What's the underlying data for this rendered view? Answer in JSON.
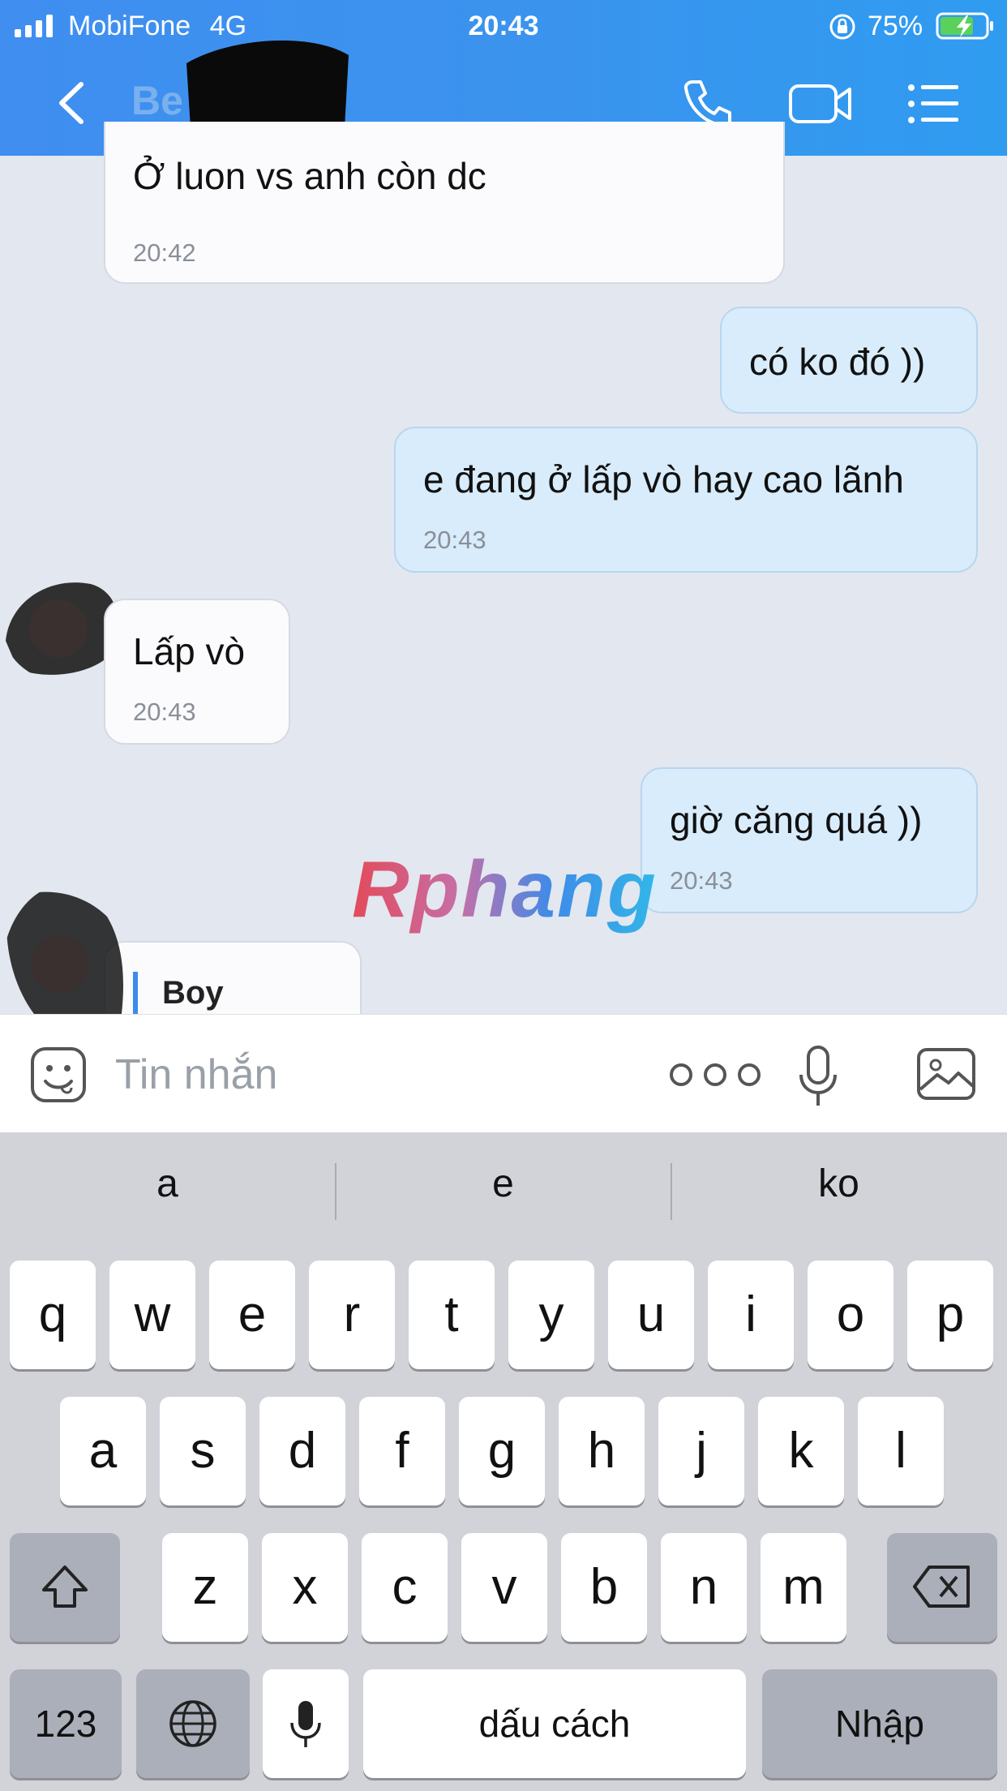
{
  "status_bar": {
    "carrier": "MobiFone",
    "network": "4G",
    "time": "20:43",
    "battery": "75%",
    "icons": [
      "signal-bars-icon",
      "orientation-lock-icon",
      "battery-charging-icon"
    ]
  },
  "header": {
    "contact_name": "Be",
    "actions": [
      "back-icon",
      "phone-icon",
      "video-call-icon",
      "menu-icon"
    ]
  },
  "messages": [
    {
      "direction": "incoming",
      "text": "Ở luon vs anh còn dc",
      "time": "20:42"
    },
    {
      "direction": "outgoing",
      "text": "có ko đó ))",
      "time": ""
    },
    {
      "direction": "outgoing",
      "text": "e đang ở lấp vò hay cao lãnh",
      "time": "20:43"
    },
    {
      "direction": "incoming",
      "text": "Lấp vò",
      "time": "20:43"
    },
    {
      "direction": "outgoing",
      "text": "giờ căng quá ))",
      "time": "20:43"
    },
    {
      "direction": "incoming",
      "reply_to": "Boy",
      "text": "",
      "time": ""
    }
  ],
  "watermark": "Rphang",
  "composer": {
    "placeholder": "Tin nhắn",
    "icons": [
      "sticker-icon",
      "more-options-icon",
      "microphone-icon",
      "image-icon"
    ]
  },
  "keyboard": {
    "suggestions": [
      "a",
      "e",
      "ko"
    ],
    "row1": [
      "q",
      "w",
      "e",
      "r",
      "t",
      "y",
      "u",
      "i",
      "o",
      "p"
    ],
    "row2": [
      "a",
      "s",
      "d",
      "f",
      "g",
      "h",
      "j",
      "k",
      "l"
    ],
    "row3": [
      "z",
      "x",
      "c",
      "v",
      "b",
      "n",
      "m"
    ],
    "numbers_key": "123",
    "space_key": "dấu cách",
    "return_key": "Nhập"
  },
  "colors": {
    "header_blue": "#3b93ee",
    "outgoing_bubble": "#d8ecfb",
    "incoming_bubble": "#fbfbfd",
    "chat_background": "#e3e7ef",
    "keyboard_background": "#d1d3d9"
  }
}
